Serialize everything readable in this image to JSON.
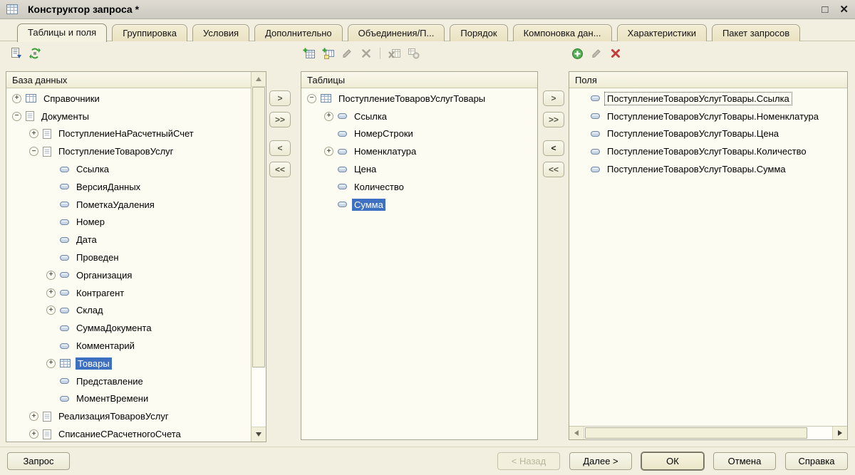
{
  "window": {
    "title": "Конструктор запроса *",
    "icon": "query-builder-icon",
    "maximize_glyph": "□",
    "close_glyph": "✕"
  },
  "tabs": [
    {
      "label": "Таблицы и поля",
      "active": true
    },
    {
      "label": "Группировка",
      "active": false
    },
    {
      "label": "Условия",
      "active": false
    },
    {
      "label": "Дополнительно",
      "active": false
    },
    {
      "label": "Объединения/П...",
      "active": false
    },
    {
      "label": "Порядок",
      "active": false
    },
    {
      "label": "Компоновка дан...",
      "active": false
    },
    {
      "label": "Характеристики",
      "active": false
    },
    {
      "label": "Пакет запросов",
      "active": false
    }
  ],
  "toolbars": {
    "database": [
      {
        "icon": "query-text-icon",
        "enabled": true
      },
      {
        "icon": "query-options-icon",
        "enabled": true
      }
    ],
    "tables": [
      {
        "icon": "add-table-icon",
        "enabled": true
      },
      {
        "icon": "add-nested-table-icon",
        "enabled": true
      },
      {
        "icon": "edit-icon",
        "enabled": false
      },
      {
        "icon": "delete-icon-gray",
        "enabled": false
      },
      {
        "icon": "separator"
      },
      {
        "icon": "virtual-table-icon",
        "enabled": false
      },
      {
        "icon": "table-params-icon",
        "enabled": false
      }
    ],
    "fields": [
      {
        "icon": "add-circle-icon",
        "enabled": true
      },
      {
        "icon": "edit-icon",
        "enabled": false
      },
      {
        "icon": "delete-icon-red",
        "enabled": true
      }
    ]
  },
  "panels": {
    "database": {
      "header": "База данных",
      "rows": [
        {
          "indent": 0,
          "expander": "plus",
          "icon": "catalog",
          "label": "Справочники"
        },
        {
          "indent": 0,
          "expander": "minus",
          "icon": "doc",
          "label": "Документы"
        },
        {
          "indent": 1,
          "expander": "plus",
          "icon": "doc",
          "label": "ПоступлениеНаРасчетныйСчет"
        },
        {
          "indent": 1,
          "expander": "minus",
          "icon": "doc",
          "label": "ПоступлениеТоваровУслуг"
        },
        {
          "indent": 2,
          "expander": null,
          "icon": "field",
          "label": "Ссылка"
        },
        {
          "indent": 2,
          "expander": null,
          "icon": "field",
          "label": "ВерсияДанных"
        },
        {
          "indent": 2,
          "expander": null,
          "icon": "field",
          "label": "ПометкаУдаления"
        },
        {
          "indent": 2,
          "expander": null,
          "icon": "field",
          "label": "Номер"
        },
        {
          "indent": 2,
          "expander": null,
          "icon": "field",
          "label": "Дата"
        },
        {
          "indent": 2,
          "expander": null,
          "icon": "field",
          "label": "Проведен"
        },
        {
          "indent": 2,
          "expander": "plus",
          "icon": "field",
          "label": "Организация"
        },
        {
          "indent": 2,
          "expander": "plus",
          "icon": "field",
          "label": "Контрагент"
        },
        {
          "indent": 2,
          "expander": "plus",
          "icon": "field",
          "label": "Склад"
        },
        {
          "indent": 2,
          "expander": null,
          "icon": "field",
          "label": "СуммаДокумента"
        },
        {
          "indent": 2,
          "expander": null,
          "icon": "field",
          "label": "Комментарий"
        },
        {
          "indent": 2,
          "expander": "plus",
          "icon": "table",
          "label": "Товары",
          "selected": true
        },
        {
          "indent": 2,
          "expander": null,
          "icon": "field",
          "label": "Представление"
        },
        {
          "indent": 2,
          "expander": null,
          "icon": "field",
          "label": "МоментВремени"
        },
        {
          "indent": 1,
          "expander": "plus",
          "icon": "doc",
          "label": "РеализацияТоваровУслуг"
        },
        {
          "indent": 1,
          "expander": "plus",
          "icon": "doc",
          "label": "СписаниеСРасчетногоСчета"
        }
      ]
    },
    "tables": {
      "header": "Таблицы",
      "rows": [
        {
          "indent": 0,
          "expander": "minus",
          "icon": "table",
          "label": "ПоступлениеТоваровУслугТовары"
        },
        {
          "indent": 1,
          "expander": "plus",
          "icon": "field",
          "label": "Ссылка"
        },
        {
          "indent": 1,
          "expander": null,
          "icon": "field",
          "label": "НомерСтроки"
        },
        {
          "indent": 1,
          "expander": "plus",
          "icon": "field",
          "label": "Номенклатура"
        },
        {
          "indent": 1,
          "expander": null,
          "icon": "field",
          "label": "Цена"
        },
        {
          "indent": 1,
          "expander": null,
          "icon": "field",
          "label": "Количество"
        },
        {
          "indent": 1,
          "expander": null,
          "icon": "field",
          "label": "Сумма",
          "selected": true
        }
      ]
    },
    "fields": {
      "header": "Поля",
      "rows": [
        {
          "icon": "field",
          "label": "ПоступлениеТоваровУслугТовары.Ссылка",
          "focused": true
        },
        {
          "icon": "field",
          "label": "ПоступлениеТоваровУслугТовары.Номенклатура"
        },
        {
          "icon": "field",
          "label": "ПоступлениеТоваровУслугТовары.Цена"
        },
        {
          "icon": "field",
          "label": "ПоступлениеТоваровУслугТовары.Количество"
        },
        {
          "icon": "field",
          "label": "ПоступлениеТоваровУслугТовары.Сумма"
        }
      ]
    }
  },
  "transfer": {
    "buttons": [
      {
        "name": "move-right",
        "label": ">"
      },
      {
        "name": "move-all-right",
        "label": ">>"
      },
      {
        "name": "move-left",
        "label": "<"
      },
      {
        "name": "move-all-left",
        "label": "<<"
      }
    ]
  },
  "footer": {
    "query": "Запрос",
    "back": "< Назад",
    "next": "Далее >",
    "ok": "ОК",
    "cancel": "Отмена",
    "help": "Справка"
  },
  "colors": {
    "selection_blue": "#3d70c0",
    "window_bg": "#f2efe0",
    "titlebar_gray": "#d5d2ca",
    "panel_bg": "#fdfcf3",
    "accent_green": "#3a9e3a",
    "accent_red": "#c43d3d",
    "disabled_gray": "#aeac9e"
  }
}
